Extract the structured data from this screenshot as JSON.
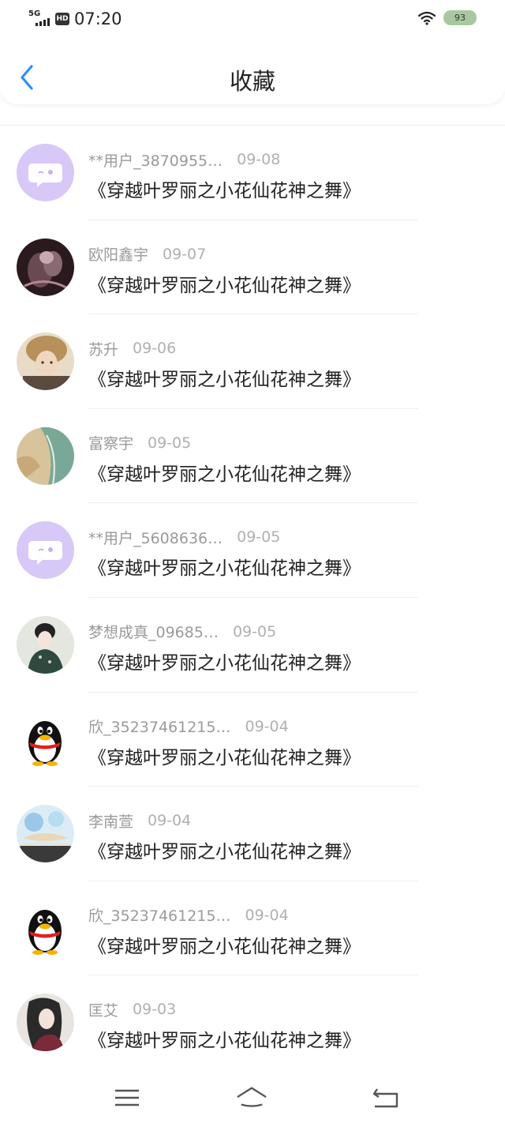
{
  "status_bar": {
    "network": "5G",
    "hd_badge": "HD",
    "time": "07:20",
    "battery": "93",
    "icons": [
      "signal-icon",
      "wifi-icon",
      "battery-icon"
    ]
  },
  "header": {
    "title": "收藏",
    "back_icon": "chevron-left-icon"
  },
  "favorites": [
    {
      "name": "**用户_3870955…",
      "date": "09-08",
      "title": "《穿越叶罗丽之小花仙花神之舞》",
      "avatar": "chat-bubble-avatar"
    },
    {
      "name": "欧阳鑫宇",
      "date": "09-07",
      "title": "《穿越叶罗丽之小花仙花神之舞》",
      "avatar": "photo-avatar-dark"
    },
    {
      "name": "苏升",
      "date": "09-06",
      "title": "《穿越叶罗丽之小花仙花神之舞》",
      "avatar": "photo-avatar-portrait"
    },
    {
      "name": "富察宇",
      "date": "09-05",
      "title": "《穿越叶罗丽之小花仙花神之舞》",
      "avatar": "photo-avatar-sea"
    },
    {
      "name": "**用户_5608636…",
      "date": "09-05",
      "title": "《穿越叶罗丽之小花仙花神之舞》",
      "avatar": "chat-bubble-avatar"
    },
    {
      "name": "梦想成真_09685…",
      "date": "09-05",
      "title": "《穿越叶罗丽之小花仙花神之舞》",
      "avatar": "illustration-avatar-lady"
    },
    {
      "name": "欣_35237461215…",
      "date": "09-04",
      "title": "《穿越叶罗丽之小花仙花神之舞》",
      "avatar": "qq-penguin-avatar"
    },
    {
      "name": "李南萱",
      "date": "09-04",
      "title": "《穿越叶罗丽之小花仙花神之舞》",
      "avatar": "illustration-avatar-boat"
    },
    {
      "name": "欣_35237461215…",
      "date": "09-04",
      "title": "《穿越叶罗丽之小花仙花神之舞》",
      "avatar": "qq-penguin-avatar"
    },
    {
      "name": "匡艾",
      "date": "09-03",
      "title": "《穿越叶罗丽之小花仙花神之舞》",
      "avatar": "illustration-avatar-hair"
    }
  ],
  "nav_bar": {
    "icons": [
      "menu-icon",
      "home-icon",
      "back-icon"
    ]
  },
  "colors": {
    "accent": "#2f8ff0",
    "text_primary": "#222222",
    "text_secondary": "#9a9a9a",
    "avatar_purple": "#d8c8f8"
  }
}
